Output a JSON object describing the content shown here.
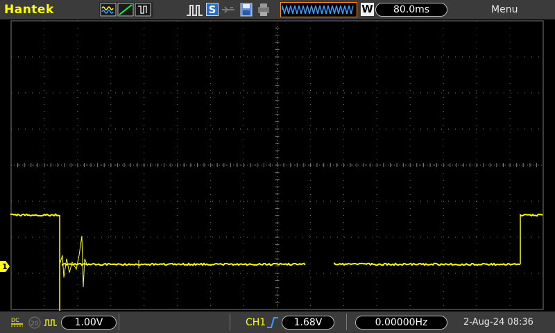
{
  "header": {
    "brand": "Hantek",
    "acquire_mode_label": "W",
    "timebase": "80.0ms",
    "menu_label": "Menu",
    "run_state_label": "S"
  },
  "channel1": {
    "marker_label": "1",
    "coupling": "DC",
    "bandwidth_limit": "20",
    "volts_per_div": "1.00V"
  },
  "trigger": {
    "source": "CH1",
    "level": "1.68V",
    "frequency": "0.00000Hz"
  },
  "status": {
    "datetime": "2-Aug-24 08:36"
  },
  "colors": {
    "trace": "#ffff00",
    "accent_orange": "#ff8c1a",
    "grid": "#7a7a7a"
  }
}
